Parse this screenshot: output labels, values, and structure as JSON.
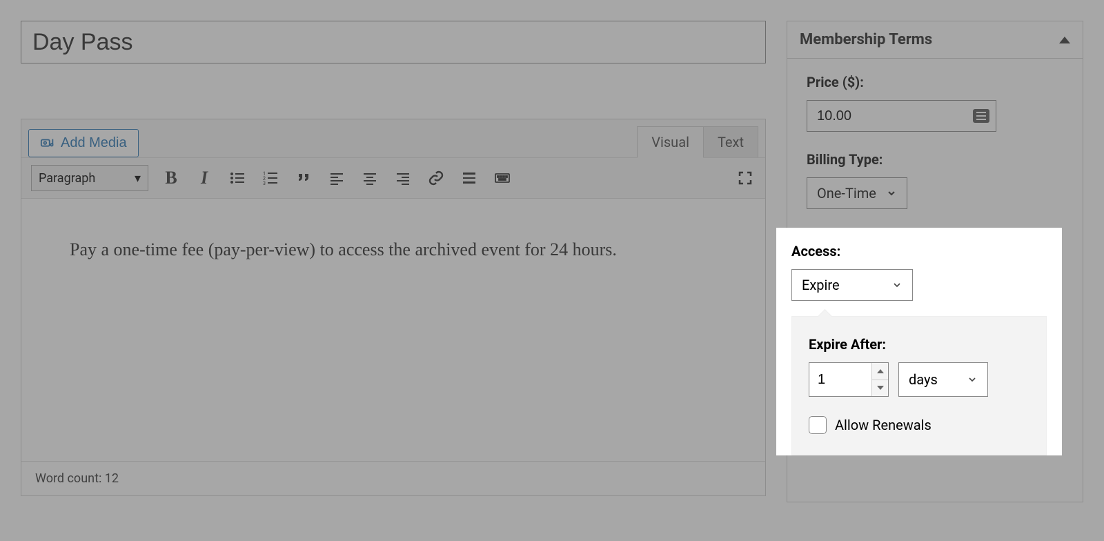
{
  "title": "Day Pass",
  "add_media_label": "Add Media",
  "editor_tabs": {
    "visual": "Visual",
    "text": "Text"
  },
  "paragraph_label": "Paragraph",
  "content_text": "Pay a one-time fee (pay-per-view) to access the archived event for 24 hours.",
  "word_count_label": "Word count: 12",
  "panel": {
    "title": "Membership Terms",
    "price_label": "Price ($):",
    "price_value": "10.00",
    "billing_label": "Billing Type:",
    "billing_value": "One-Time",
    "access_label": "Access:",
    "access_value": "Expire",
    "expire_after_label": "Expire After:",
    "expire_qty": "1",
    "expire_unit": "days",
    "renewals_label": "Allow Renewals"
  }
}
